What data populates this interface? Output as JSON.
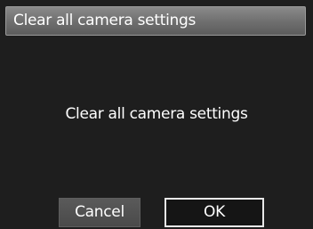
{
  "dialog": {
    "title": "Clear all camera settings",
    "message": "Clear all camera settings",
    "cancel_label": "Cancel",
    "ok_label": "OK",
    "selected_button": "OK"
  }
}
